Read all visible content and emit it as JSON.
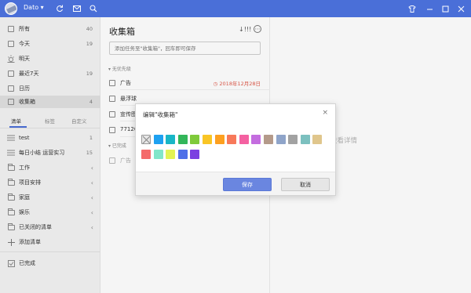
{
  "titlebar": {
    "user": "Dato",
    "icons": [
      "refresh-icon",
      "mail-icon",
      "search-icon"
    ],
    "window_controls": [
      "skin-icon",
      "minimize-icon",
      "maximize-icon",
      "close-icon"
    ]
  },
  "sidebar": {
    "smart_lists": [
      {
        "label": "所有",
        "count": "40",
        "icon": "inbox-icon"
      },
      {
        "label": "今天",
        "count": "19",
        "icon": "calendar-today-icon"
      },
      {
        "label": "明天",
        "count": "",
        "icon": "sun-icon"
      },
      {
        "label": "最近7天",
        "count": "19",
        "icon": "calendar-week-icon"
      },
      {
        "label": "日历",
        "count": "",
        "icon": "calendar-icon"
      },
      {
        "label": "收集箱",
        "count": "4",
        "icon": "inbox-tray-icon"
      }
    ],
    "tabs": [
      "清单",
      "标签",
      "自定义"
    ],
    "lists": [
      {
        "label": "test",
        "count": "1",
        "arrow": ""
      },
      {
        "label": "每日小结 运营实习",
        "count": "15",
        "arrow": ""
      },
      {
        "label": "工作",
        "count": "",
        "arrow": "‹"
      },
      {
        "label": "项目安排",
        "count": "",
        "arrow": "‹"
      },
      {
        "label": "家庭",
        "count": "",
        "arrow": "‹"
      },
      {
        "label": "娱乐",
        "count": "",
        "arrow": "‹"
      },
      {
        "label": "已关闭的清单",
        "count": "",
        "arrow": "‹"
      },
      {
        "label": "添加清单",
        "count": "",
        "arrow": ""
      }
    ],
    "completed": "已完成"
  },
  "list": {
    "title": "收集箱",
    "sort_label": "↓!!!",
    "more_label": "⋯",
    "add_placeholder": "添加任务至\"收集箱\"，回车即可保存",
    "section_priority": "无优先级",
    "tasks": [
      {
        "text": "广告",
        "date": "2018年12月28日"
      },
      {
        "text": "悬浮球",
        "date": ""
      },
      {
        "text": "宣传图",
        "date": ""
      },
      {
        "text": "77120",
        "date": ""
      }
    ],
    "section_done": "已完成",
    "done_tasks": [
      {
        "text": "广告"
      }
    ]
  },
  "detail": {
    "hint": "点击任务标题查看详情"
  },
  "dialog": {
    "title": "编辑\"收集箱\"",
    "close": "×",
    "colors": [
      "#1ea1f1",
      "#19b6c6",
      "#33b65a",
      "#7fca3b",
      "#f9c525",
      "#fda020",
      "#f7795a",
      "#f461a1",
      "#c46ddf",
      "#b49a8a",
      "#8fa4c9",
      "#a2a2a2",
      "#7cc0bf",
      "#e0c68c",
      "#f46a6a",
      "#82e6c9",
      "#e3f354",
      "#4f6fe8",
      "#7c3fe1"
    ],
    "save": "保存",
    "cancel": "取消"
  }
}
